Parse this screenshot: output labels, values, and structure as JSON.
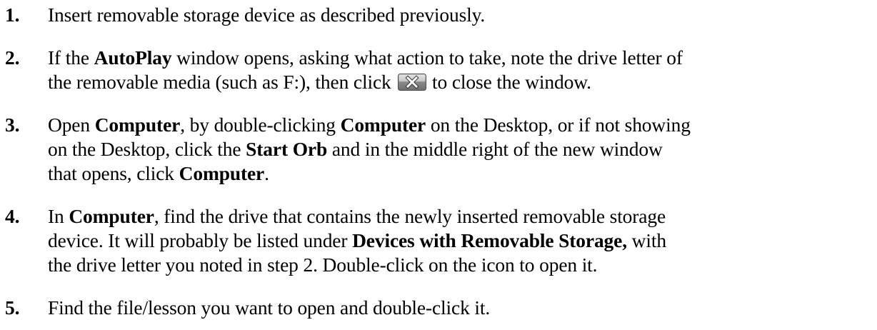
{
  "steps": [
    {
      "number": "1.",
      "lines": [
        [
          "Insert removable storage device as described previously."
        ]
      ]
    },
    {
      "number": "2.",
      "lines": [
        [
          "If the ",
          "AutoPlay",
          " window opens, asking what action to take, note the drive letter of"
        ],
        [
          "the removable media (such as F:), then click ",
          " to close the window."
        ]
      ]
    },
    {
      "number": "3.",
      "lines": [
        [
          "Open ",
          "Computer",
          ", by double-clicking ",
          "Computer",
          " on the Desktop, or if not showing"
        ],
        [
          "on the Desktop, click the ",
          "Start Orb",
          " and in the middle right of the new window"
        ],
        [
          "that opens, click ",
          "Computer",
          "."
        ]
      ]
    },
    {
      "number": "4.",
      "lines": [
        [
          "In ",
          "Computer",
          ", find the drive that contains the newly inserted removable storage"
        ],
        [
          "device. It will probably be listed under ",
          "Devices with Removable Storage,",
          " with"
        ],
        [
          "the drive letter you noted in step 2.  Double-click on the icon to open it."
        ]
      ]
    },
    {
      "number": "5.",
      "lines": [
        [
          "Find the file/lesson you want to open and double-click it."
        ]
      ]
    }
  ],
  "icons": {
    "close_button": "close-button-icon",
    "close_button_color": "#8c8c8c"
  }
}
